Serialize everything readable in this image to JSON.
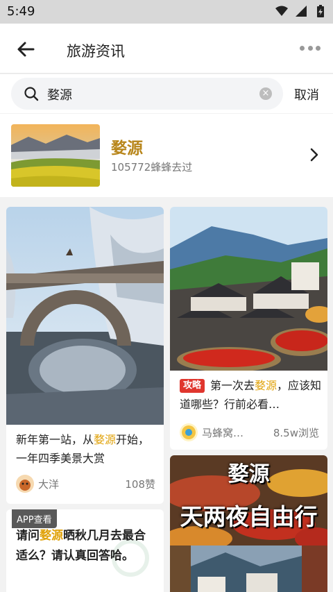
{
  "status": {
    "time": "5:49"
  },
  "nav": {
    "title": "旅游资讯"
  },
  "search": {
    "query": "婺源",
    "cancel_label": "取消",
    "clear_glyph": "×"
  },
  "destination": {
    "name": "婺源",
    "visitors_text": "105772蜂蜂去过"
  },
  "cards": [
    {
      "title_before": "新年第一站，从",
      "title_highlight": "婺源",
      "title_after": "开始，一年四季美景大赏",
      "author": "大洋",
      "stat": "108赞"
    },
    {
      "tag": "攻略",
      "title_before": "第一次去",
      "title_highlight": "婺源",
      "title_after": "，应该知道哪些？行前必看…",
      "author": "马蜂窝…",
      "stat": "8.5w浏览"
    },
    {
      "badge": "APP查看",
      "title_before": "请问",
      "title_highlight": "婺源",
      "title_after": "晒秋几月去最合适么？请认真回答哈。"
    },
    {
      "overlay_line1": "婺源",
      "overlay_line2": "天两夜自由行"
    }
  ],
  "colors": {
    "accent": "#b8861b",
    "highlight": "#e0a20a",
    "tag": "#e0362e"
  }
}
